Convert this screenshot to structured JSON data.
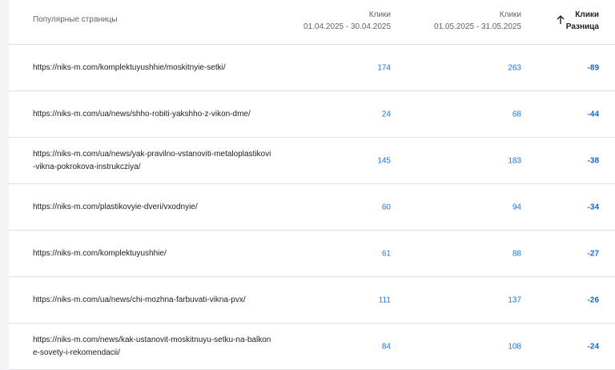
{
  "header": {
    "page_col": "Популярные страницы",
    "col1_title": "Клики",
    "col1_range": "01.04.2025 - 30.04.2025",
    "col2_title": "Клики",
    "col2_range": "01.05.2025 - 31.05.2025",
    "col3_title": "Клики",
    "col3_sub": "Разница",
    "sort_icon": "arrow-up-icon"
  },
  "rows": [
    {
      "url": "https://niks-m.com/komplektuyushhie/moskitnyie-setki/",
      "clicks_apr": "174",
      "clicks_may": "263",
      "diff": "-89"
    },
    {
      "url": "https://niks-m.com/ua/news/shho-robiti-yakshho-z-vikon-dme/",
      "clicks_apr": "24",
      "clicks_may": "68",
      "diff": "-44"
    },
    {
      "url": "https://niks-m.com/ua/news/yak-pravilno-vstanoviti-metaloplastikovi-vikna-pokrokova-instrukcziya/",
      "clicks_apr": "145",
      "clicks_may": "183",
      "diff": "-38"
    },
    {
      "url": "https://niks-m.com/plastikovyie-dveri/vxodnyie/",
      "clicks_apr": "60",
      "clicks_may": "94",
      "diff": "-34"
    },
    {
      "url": "https://niks-m.com/komplektuyushhie/",
      "clicks_apr": "61",
      "clicks_may": "88",
      "diff": "-27"
    },
    {
      "url": "https://niks-m.com/ua/news/chi-mozhna-farbuvati-vikna-pvx/",
      "clicks_apr": "111",
      "clicks_may": "137",
      "diff": "-26"
    },
    {
      "url": "https://niks-m.com/news/kak-ustanovit-moskitnuyu-setku-na-balkone-sovety-i-rekomendacii/",
      "clicks_apr": "84",
      "clicks_may": "108",
      "diff": "-24"
    }
  ]
}
